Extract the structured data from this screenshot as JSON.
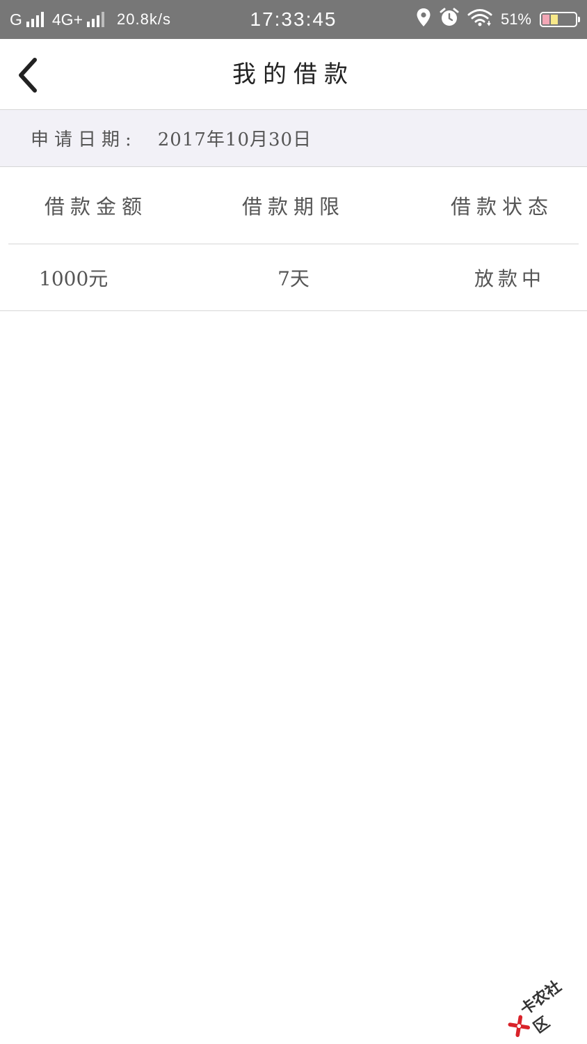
{
  "status_bar": {
    "network_1": "G",
    "network_2": "4G+",
    "speed": "20.8k/s",
    "time": "17:33:45",
    "battery": "51%",
    "icons": [
      "signal-icon",
      "location-pin-icon",
      "alarm-icon",
      "wifi-icon",
      "battery-icon"
    ]
  },
  "header": {
    "title": "我的借款",
    "back_icon": "chevron-left-icon"
  },
  "application": {
    "date_label": "申请日期:",
    "date_value": "2017年10月30日"
  },
  "table": {
    "headers": [
      "借款金额",
      "借款期限",
      "借款状态"
    ],
    "rows": [
      {
        "amount": "1000元",
        "term": "7天",
        "status": "放款中"
      }
    ]
  },
  "watermark": {
    "text": "卡农社区",
    "icon": "kanong-logo-icon"
  },
  "colors": {
    "status_bar": "#777777",
    "date_bar": "#f2f1f7",
    "text": "#555555",
    "title": "#222222",
    "divider": "#d6d6d6",
    "logo_red": "#d9232a"
  }
}
